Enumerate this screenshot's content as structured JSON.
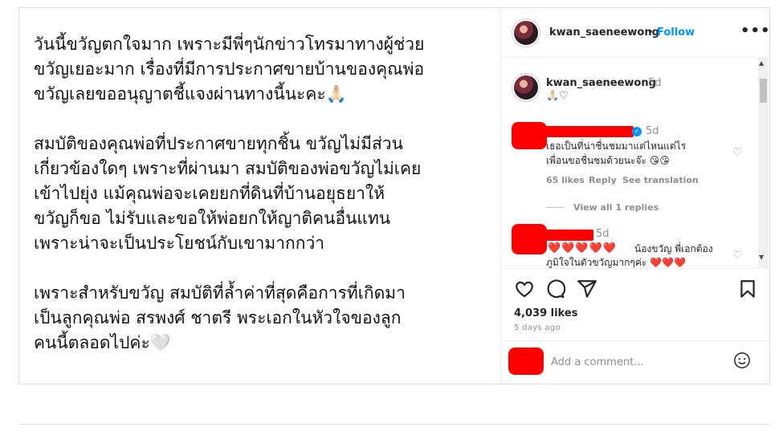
{
  "post": {
    "caption_paragraphs": [
      "วันนี้ขวัญตกใจมาก เพราะมีพี่ๆนักข่าวโทรมาทางผู้ช่วย\nขวัญเยอะมาก เรื่องที่มีการประกาศขายบ้านของคุณพ่อ\nขวัญเลยขออนุญาตชี้แจงผ่านทางนี้นะคะ🙏🏻",
      "สมบัติของคุณพ่อที่ประกาศขายทุกชิ้น ขวัญไม่มีส่วน\nเกี่ยวข้องใดๆ เพราะที่ผ่านมา สมบัติของพ่อขวัญไม่เคย\nเข้าไปยุ่ง แม้คุณพ่อจะเคยยกที่ดินที่บ้านอยุธยาให้\nขวัญก็ขอ ไม่รับและขอให้พ่อยกให้ญาติคนอื่นแทน\nเพราะน่าจะเป็นประโยชน์กับเขามากกว่า",
      "เพราะสำหรับขวัญ สมบัติที่ล้ำค่าที่สุดคือการที่เกิดมา\nเป็นลูกคุณพ่อ สรพงศ์ ชาตรี พระเอกในหัวใจของลูก\nคนนี้ตลอดไปค่ะ🤍"
    ]
  },
  "header": {
    "username": "kwan_saeneewong",
    "separator": "•",
    "follow_label": "Follow",
    "more_label": "•••"
  },
  "caption_comment": {
    "username": "kwan_saeneewong",
    "age": "5d",
    "emojis": "🙏🏻♡"
  },
  "comments": [
    {
      "age": "5d",
      "text": "เธอเป็นที่น่าชื่นชมมาแต่ไหนแต่ไร\nเพื่อนขอชื่นชมด้วยนะจ๊ะ 😘😘",
      "likes": "65 likes",
      "reply": "Reply",
      "translate": "See translation",
      "view_replies": "View all 1 replies"
    },
    {
      "age": "5d",
      "hearts": "❤️❤️❤️❤️❤️",
      "text": "น้องขวัญ พี่เอกต้อง",
      "text2": "ภูมิใจในตัวขวัญมากๆค่ะ ❤️❤️❤️"
    }
  ],
  "actions": {
    "likes": "4,039 likes",
    "posted": "5 days ago"
  },
  "add_comment": {
    "placeholder": "Add a comment..."
  },
  "colors": {
    "accent": "#0095f6",
    "redaction": "#ff0000",
    "muted": "#8e8e8e"
  }
}
